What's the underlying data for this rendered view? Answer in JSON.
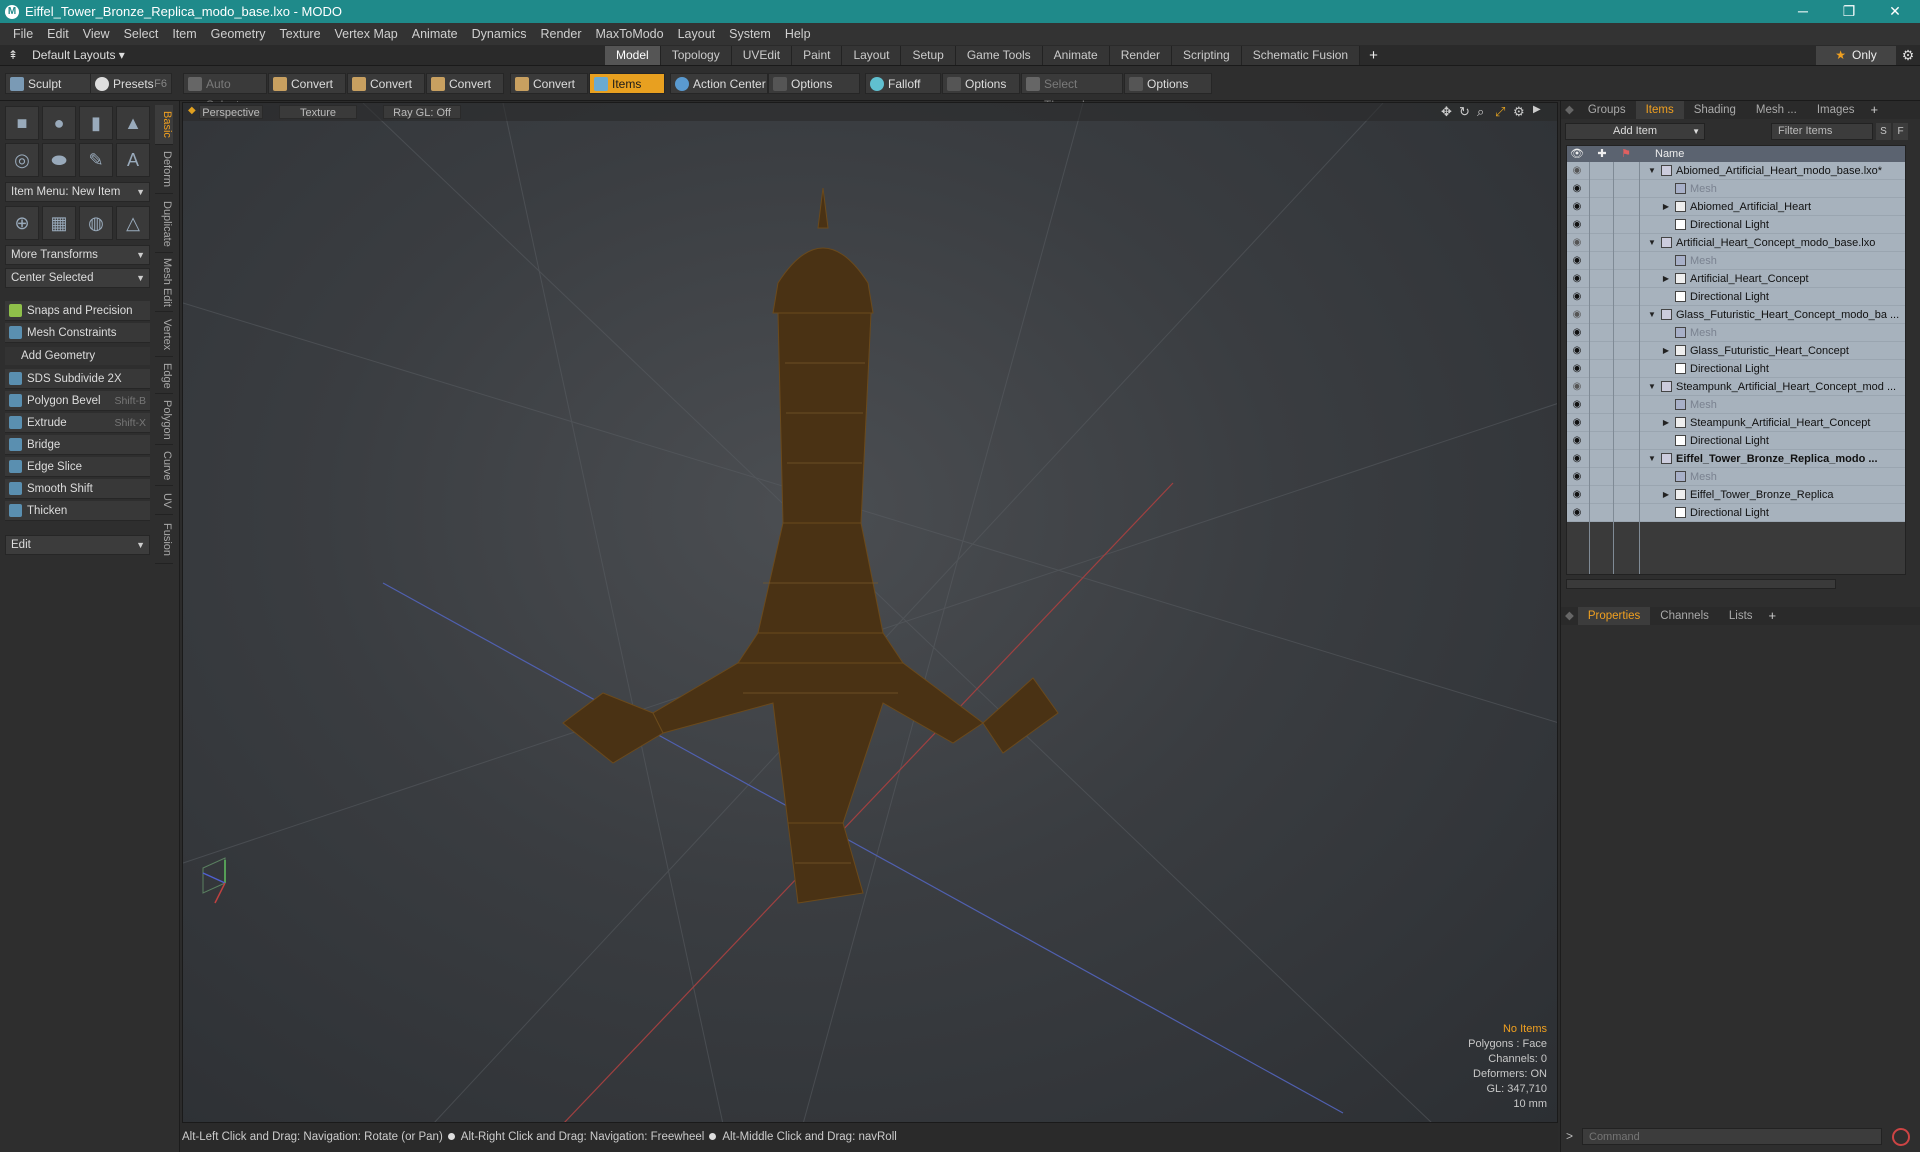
{
  "window": {
    "title": "Eiffel_Tower_Bronze_Replica_modo_base.lxo - MODO",
    "minimize": "─",
    "maximize": "❐",
    "close": "✕"
  },
  "menus": [
    "File",
    "Edit",
    "View",
    "Select",
    "Item",
    "Geometry",
    "Texture",
    "Vertex Map",
    "Animate",
    "Dynamics",
    "Render",
    "MaxToModo",
    "Layout",
    "System",
    "Help"
  ],
  "layoutbar": {
    "layouts_label": "Default Layouts",
    "tabs": [
      "Model",
      "Topology",
      "UVEdit",
      "Paint",
      "Layout",
      "Setup",
      "Game Tools",
      "Animate",
      "Render",
      "Scripting",
      "Schematic Fusion"
    ],
    "active_tab": "Model",
    "plus": "+",
    "only_label": "Only"
  },
  "toolbar": {
    "sculpt": "Sculpt",
    "presets": "Presets",
    "presets_key": "F6",
    "auto_select": "Auto Select",
    "convert": "Convert",
    "items": "Items",
    "action_center": "Action Center",
    "options": "Options",
    "falloff": "Falloff",
    "select_through": "Select Through"
  },
  "leftpanel": {
    "item_menu": "Item Menu: New Item",
    "more_transforms": "More Transforms",
    "center_selected": "Center Selected",
    "snaps": "Snaps and Precision",
    "mesh_constraints": "Mesh Constraints",
    "add_geometry": "Add Geometry",
    "tools": [
      {
        "label": "SDS Subdivide 2X",
        "key": ""
      },
      {
        "label": "Polygon Bevel",
        "key": "Shift-B"
      },
      {
        "label": "Extrude",
        "key": "Shift-X"
      },
      {
        "label": "Bridge",
        "key": ""
      },
      {
        "label": "Edge Slice",
        "key": ""
      },
      {
        "label": "Smooth Shift",
        "key": ""
      },
      {
        "label": "Thicken",
        "key": ""
      }
    ],
    "edit_dd": "Edit",
    "vtabs": [
      "Basic",
      "Deform",
      "Duplicate",
      "Mesh Edit",
      "Vertex",
      "Edge",
      "Polygon",
      "Curve",
      "UV",
      "Fusion"
    ]
  },
  "viewport": {
    "perspective": "Perspective",
    "texture": "Texture",
    "raygl": "Ray GL: Off",
    "info": {
      "no_items": "No Items",
      "polygons": "Polygons : Face",
      "channels": "Channels: 0",
      "deformers": "Deformers: ON",
      "gl": "GL: 347,710",
      "scale": "10 mm"
    },
    "model_color": "#4a3214"
  },
  "statusbar": {
    "hint1": "Alt-Left Click and Drag: Navigation: Rotate (or Pan)",
    "hint2": "Alt-Right Click and Drag: Navigation: Freewheel",
    "hint3": "Alt-Middle Click and Drag: navRoll"
  },
  "rightpanel": {
    "tabs": [
      "Groups",
      "Items",
      "Shading",
      "Mesh ...",
      "Images"
    ],
    "active_tab": "Items",
    "add_item": "Add Item",
    "filter_placeholder": "Filter Items",
    "filter_s": "S",
    "filter_f": "F",
    "name_col": "Name",
    "rows": [
      {
        "label": "Abiomed_Artificial_Heart_modo_base.lxo*",
        "level": 0,
        "kind": "scene",
        "expand": "▼",
        "dim": false,
        "bold": false,
        "eye": false
      },
      {
        "label": "Mesh",
        "level": 1,
        "kind": "mesh",
        "expand": "",
        "dim": true,
        "bold": false,
        "eye": true
      },
      {
        "label": "Abiomed_Artificial_Heart",
        "level": 1,
        "kind": "group",
        "expand": "▶",
        "dim": false,
        "bold": false,
        "eye": true
      },
      {
        "label": "Directional Light",
        "level": 1,
        "kind": "light",
        "expand": "",
        "dim": false,
        "bold": false,
        "eye": true
      },
      {
        "label": "Artificial_Heart_Concept_modo_base.lxo",
        "level": 0,
        "kind": "scene",
        "expand": "▼",
        "dim": false,
        "bold": false,
        "eye": false
      },
      {
        "label": "Mesh",
        "level": 1,
        "kind": "mesh",
        "expand": "",
        "dim": true,
        "bold": false,
        "eye": true
      },
      {
        "label": "Artificial_Heart_Concept",
        "level": 1,
        "kind": "group",
        "expand": "▶",
        "dim": false,
        "bold": false,
        "eye": true
      },
      {
        "label": "Directional Light",
        "level": 1,
        "kind": "light",
        "expand": "",
        "dim": false,
        "bold": false,
        "eye": true
      },
      {
        "label": "Glass_Futuristic_Heart_Concept_modo_ba ...",
        "level": 0,
        "kind": "scene",
        "expand": "▼",
        "dim": false,
        "bold": false,
        "eye": false
      },
      {
        "label": "Mesh",
        "level": 1,
        "kind": "mesh",
        "expand": "",
        "dim": true,
        "bold": false,
        "eye": true
      },
      {
        "label": "Glass_Futuristic_Heart_Concept",
        "level": 1,
        "kind": "group",
        "expand": "▶",
        "dim": false,
        "bold": false,
        "eye": true
      },
      {
        "label": "Directional Light",
        "level": 1,
        "kind": "light",
        "expand": "",
        "dim": false,
        "bold": false,
        "eye": true
      },
      {
        "label": "Steampunk_Artificial_Heart_Concept_mod ...",
        "level": 0,
        "kind": "scene",
        "expand": "▼",
        "dim": false,
        "bold": false,
        "eye": false
      },
      {
        "label": "Mesh",
        "level": 1,
        "kind": "mesh",
        "expand": "",
        "dim": true,
        "bold": false,
        "eye": true
      },
      {
        "label": "Steampunk_Artificial_Heart_Concept",
        "level": 1,
        "kind": "group",
        "expand": "▶",
        "dim": false,
        "bold": false,
        "eye": true
      },
      {
        "label": "Directional Light",
        "level": 1,
        "kind": "light",
        "expand": "",
        "dim": false,
        "bold": false,
        "eye": true
      },
      {
        "label": "Eiffel_Tower_Bronze_Replica_modo ...",
        "level": 0,
        "kind": "scene",
        "expand": "▼",
        "dim": false,
        "bold": true,
        "eye": true
      },
      {
        "label": "Mesh",
        "level": 1,
        "kind": "mesh",
        "expand": "",
        "dim": true,
        "bold": false,
        "eye": true
      },
      {
        "label": "Eiffel_Tower_Bronze_Replica",
        "level": 1,
        "kind": "group",
        "expand": "▶",
        "dim": false,
        "bold": false,
        "eye": true
      },
      {
        "label": "Directional Light",
        "level": 1,
        "kind": "light",
        "expand": "",
        "dim": false,
        "bold": false,
        "eye": true
      }
    ],
    "lower_tabs": [
      "Properties",
      "Channels",
      "Lists"
    ],
    "lower_active": "Properties",
    "command_placeholder": "Command",
    "command_prompt": ">"
  },
  "colors": {
    "accent": "#f0a020",
    "titlebar": "#1f8a8a",
    "items_row": "#a7b2bd"
  }
}
